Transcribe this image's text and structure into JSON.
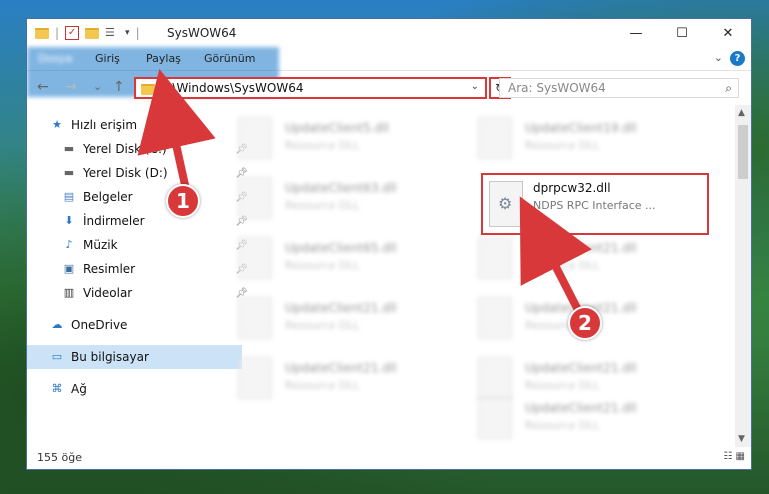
{
  "window": {
    "title": "SysWOW64",
    "controls": {
      "minimize": "—",
      "maximize": "☐",
      "close": "✕"
    }
  },
  "ribbon": {
    "tabs": [
      "Dosya",
      "Giriş",
      "Paylaş",
      "Görünüm"
    ],
    "help": "?"
  },
  "nav": {
    "back": "←",
    "forward": "→",
    "recent": "⌄",
    "up": "↑",
    "address": "C:\\Windows\\SysWOW64",
    "search_placeholder": "Ara: SysWOW64"
  },
  "sidebar": {
    "items": [
      {
        "label": "Hızlı erişim",
        "icon": "star-icon",
        "glyph": "★"
      },
      {
        "label": "Yerel Disk (C:)",
        "icon": "drive-icon",
        "glyph": "▬"
      },
      {
        "label": "Yerel Disk (D:)",
        "icon": "drive-icon",
        "glyph": "▬"
      },
      {
        "label": "Belgeler",
        "icon": "documents-icon",
        "glyph": "▤"
      },
      {
        "label": "İndirmeler",
        "icon": "download-icon",
        "glyph": "⬇"
      },
      {
        "label": "Müzik",
        "icon": "music-icon",
        "glyph": "♪"
      },
      {
        "label": "Resimler",
        "icon": "pictures-icon",
        "glyph": "▣"
      },
      {
        "label": "Videolar",
        "icon": "videos-icon",
        "glyph": "▥"
      },
      {
        "label": "OneDrive",
        "icon": "cloud-icon",
        "glyph": "☁"
      },
      {
        "label": "Bu bilgisayar",
        "icon": "computer-icon",
        "glyph": "▭"
      },
      {
        "label": "Ağ",
        "icon": "network-icon",
        "glyph": "⌘"
      }
    ]
  },
  "files": [
    {
      "name": "UpdateClient5.dll",
      "desc": "Resource DLL"
    },
    {
      "name": "UpdateClient19.dll",
      "desc": "Resource DLL"
    },
    {
      "name": "UpdateClient63.dll",
      "desc": "Resource DLL"
    },
    {
      "name": "UpdateClient65.dll",
      "desc": "Resource DLL"
    },
    {
      "name": "UpdateClient21.dll",
      "desc": "Resource DLL"
    },
    {
      "name": "UpdateClient21.dll",
      "desc": "Resource DLL"
    },
    {
      "name": "UpdateClient21.dll",
      "desc": "Resource DLL"
    },
    {
      "name": "UpdateClient21.dll",
      "desc": "Resource DLL"
    },
    {
      "name": "UpdateClient21.dll",
      "desc": "Resource DLL"
    },
    {
      "name": "UpdateClient21.dll",
      "desc": "Resource DLL"
    }
  ],
  "highlighted_file": {
    "name": "dprpcw32.dll",
    "desc": "NDPS RPC Interface ..."
  },
  "status": {
    "count": "155 öğe"
  },
  "callouts": [
    "1",
    "2"
  ],
  "colors": {
    "accent": "#1979ca",
    "highlight": "#d9383a"
  }
}
